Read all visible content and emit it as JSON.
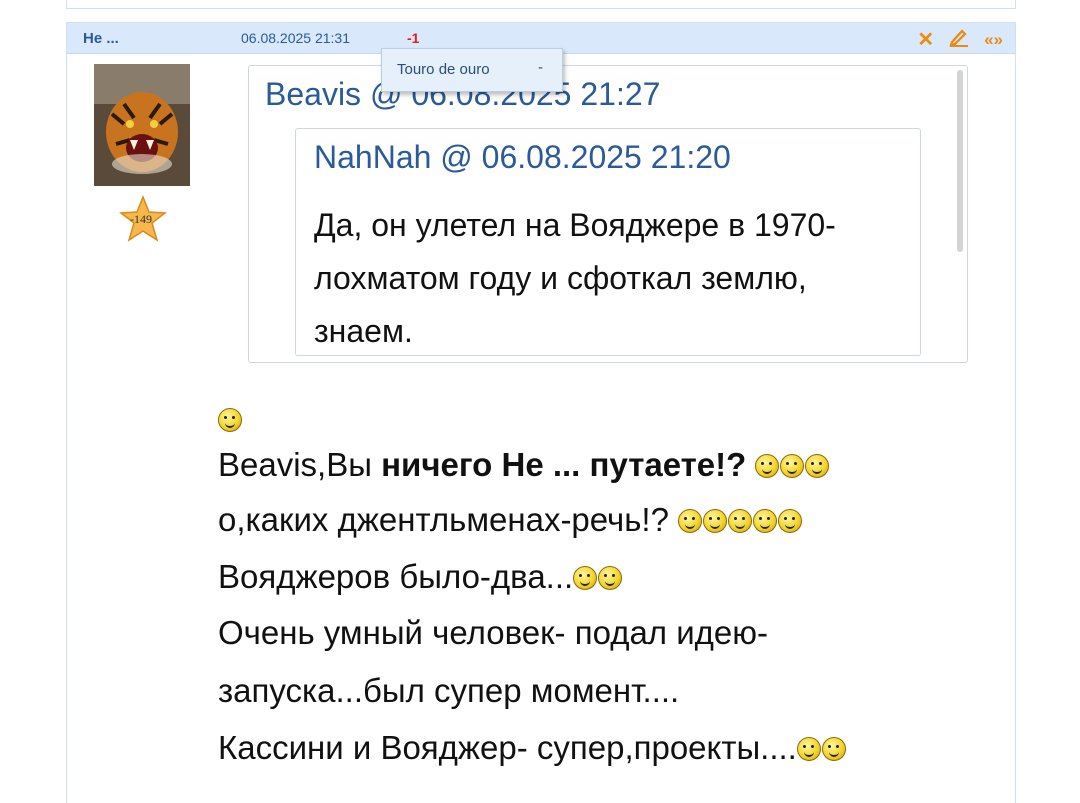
{
  "post": {
    "author": "Не ...",
    "datetime": "06.08.2025 21:31",
    "rating": "-1",
    "actions": {
      "delete_icon": "close-icon",
      "edit_icon": "pencil-icon",
      "quote_label": "«»"
    },
    "tooltip": {
      "name": "Touro de ouro",
      "value": "-"
    },
    "user_badge": "-149"
  },
  "quote_outer": {
    "author": "Beavis",
    "at": "@",
    "datetime": "06.08.2025 21:27"
  },
  "quote_inner": {
    "author": "NahNah",
    "at": "@",
    "datetime": "06.08.2025 21:20",
    "text": "Да, он улетел на Вояджере в 1970-лохматом году и сфоткал землю, знаем."
  },
  "message": {
    "line1_prefix": "Beavis,Вы ",
    "line1_bold": "ничего Не ... путаете!?",
    "line2": "о,каких джентльменах-речь!?",
    "line3": "Вояджеров было-два...",
    "line4": "Очень умный человек- подал идею-",
    "line5": "запуска...был супер момент....",
    "line6": "Кассини и Вояджер- супер,проекты...."
  },
  "colors": {
    "header_bg": "#d9e9fb",
    "link_blue": "#2a5a9a",
    "rating_red": "#e02020",
    "action_orange": "#f08a0c"
  }
}
